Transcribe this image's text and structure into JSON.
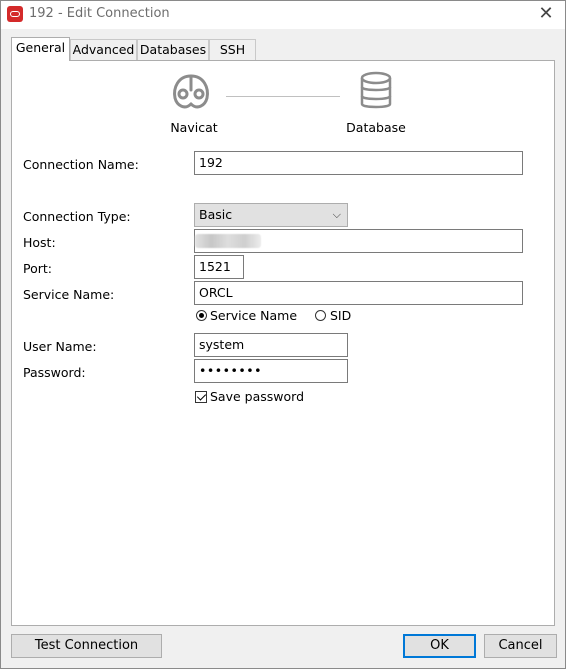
{
  "window": {
    "title": "192 - Edit Connection",
    "close": "✕"
  },
  "tabs": [
    {
      "label": "General"
    },
    {
      "label": "Advanced"
    },
    {
      "label": "Databases"
    },
    {
      "label": "SSH"
    }
  ],
  "diagram": {
    "left_label": "Navicat",
    "right_label": "Database"
  },
  "form": {
    "connection_name_label": "Connection Name:",
    "connection_name_value": "192",
    "connection_type_label": "Connection Type:",
    "connection_type_value": "Basic",
    "host_label": "Host:",
    "port_label": "Port:",
    "port_value": "1521",
    "service_name_label": "Service Name:",
    "service_name_value": "ORCL",
    "radio_service_name": "Service Name",
    "radio_sid": "SID",
    "user_name_label": "User Name:",
    "user_name_value": "system",
    "password_label": "Password:",
    "password_value": "••••••••",
    "save_password_label": "Save password"
  },
  "buttons": {
    "test": "Test Connection",
    "ok": "OK",
    "cancel": "Cancel"
  }
}
